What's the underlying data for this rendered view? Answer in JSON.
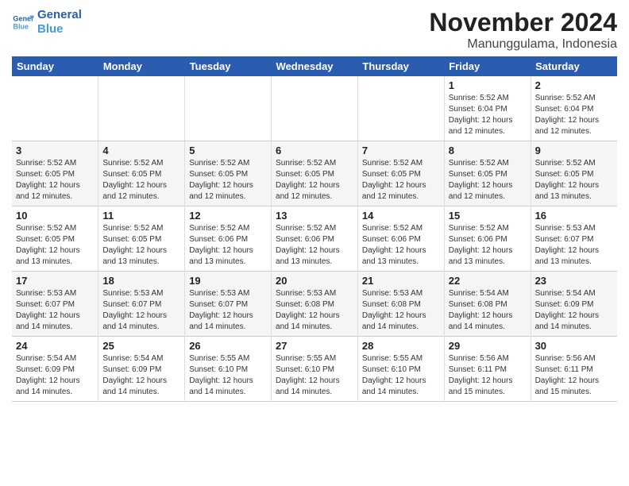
{
  "title": "November 2024",
  "subtitle": "Manunggulama, Indonesia",
  "logo": {
    "line1": "General",
    "line2": "Blue"
  },
  "weekdays": [
    "Sunday",
    "Monday",
    "Tuesday",
    "Wednesday",
    "Thursday",
    "Friday",
    "Saturday"
  ],
  "weeks": [
    [
      {
        "day": "",
        "info": ""
      },
      {
        "day": "",
        "info": ""
      },
      {
        "day": "",
        "info": ""
      },
      {
        "day": "",
        "info": ""
      },
      {
        "day": "",
        "info": ""
      },
      {
        "day": "1",
        "info": "Sunrise: 5:52 AM\nSunset: 6:04 PM\nDaylight: 12 hours\nand 12 minutes."
      },
      {
        "day": "2",
        "info": "Sunrise: 5:52 AM\nSunset: 6:04 PM\nDaylight: 12 hours\nand 12 minutes."
      }
    ],
    [
      {
        "day": "3",
        "info": "Sunrise: 5:52 AM\nSunset: 6:05 PM\nDaylight: 12 hours\nand 12 minutes."
      },
      {
        "day": "4",
        "info": "Sunrise: 5:52 AM\nSunset: 6:05 PM\nDaylight: 12 hours\nand 12 minutes."
      },
      {
        "day": "5",
        "info": "Sunrise: 5:52 AM\nSunset: 6:05 PM\nDaylight: 12 hours\nand 12 minutes."
      },
      {
        "day": "6",
        "info": "Sunrise: 5:52 AM\nSunset: 6:05 PM\nDaylight: 12 hours\nand 12 minutes."
      },
      {
        "day": "7",
        "info": "Sunrise: 5:52 AM\nSunset: 6:05 PM\nDaylight: 12 hours\nand 12 minutes."
      },
      {
        "day": "8",
        "info": "Sunrise: 5:52 AM\nSunset: 6:05 PM\nDaylight: 12 hours\nand 12 minutes."
      },
      {
        "day": "9",
        "info": "Sunrise: 5:52 AM\nSunset: 6:05 PM\nDaylight: 12 hours\nand 13 minutes."
      }
    ],
    [
      {
        "day": "10",
        "info": "Sunrise: 5:52 AM\nSunset: 6:05 PM\nDaylight: 12 hours\nand 13 minutes."
      },
      {
        "day": "11",
        "info": "Sunrise: 5:52 AM\nSunset: 6:05 PM\nDaylight: 12 hours\nand 13 minutes."
      },
      {
        "day": "12",
        "info": "Sunrise: 5:52 AM\nSunset: 6:06 PM\nDaylight: 12 hours\nand 13 minutes."
      },
      {
        "day": "13",
        "info": "Sunrise: 5:52 AM\nSunset: 6:06 PM\nDaylight: 12 hours\nand 13 minutes."
      },
      {
        "day": "14",
        "info": "Sunrise: 5:52 AM\nSunset: 6:06 PM\nDaylight: 12 hours\nand 13 minutes."
      },
      {
        "day": "15",
        "info": "Sunrise: 5:52 AM\nSunset: 6:06 PM\nDaylight: 12 hours\nand 13 minutes."
      },
      {
        "day": "16",
        "info": "Sunrise: 5:53 AM\nSunset: 6:07 PM\nDaylight: 12 hours\nand 13 minutes."
      }
    ],
    [
      {
        "day": "17",
        "info": "Sunrise: 5:53 AM\nSunset: 6:07 PM\nDaylight: 12 hours\nand 14 minutes."
      },
      {
        "day": "18",
        "info": "Sunrise: 5:53 AM\nSunset: 6:07 PM\nDaylight: 12 hours\nand 14 minutes."
      },
      {
        "day": "19",
        "info": "Sunrise: 5:53 AM\nSunset: 6:07 PM\nDaylight: 12 hours\nand 14 minutes."
      },
      {
        "day": "20",
        "info": "Sunrise: 5:53 AM\nSunset: 6:08 PM\nDaylight: 12 hours\nand 14 minutes."
      },
      {
        "day": "21",
        "info": "Sunrise: 5:53 AM\nSunset: 6:08 PM\nDaylight: 12 hours\nand 14 minutes."
      },
      {
        "day": "22",
        "info": "Sunrise: 5:54 AM\nSunset: 6:08 PM\nDaylight: 12 hours\nand 14 minutes."
      },
      {
        "day": "23",
        "info": "Sunrise: 5:54 AM\nSunset: 6:09 PM\nDaylight: 12 hours\nand 14 minutes."
      }
    ],
    [
      {
        "day": "24",
        "info": "Sunrise: 5:54 AM\nSunset: 6:09 PM\nDaylight: 12 hours\nand 14 minutes."
      },
      {
        "day": "25",
        "info": "Sunrise: 5:54 AM\nSunset: 6:09 PM\nDaylight: 12 hours\nand 14 minutes."
      },
      {
        "day": "26",
        "info": "Sunrise: 5:55 AM\nSunset: 6:10 PM\nDaylight: 12 hours\nand 14 minutes."
      },
      {
        "day": "27",
        "info": "Sunrise: 5:55 AM\nSunset: 6:10 PM\nDaylight: 12 hours\nand 14 minutes."
      },
      {
        "day": "28",
        "info": "Sunrise: 5:55 AM\nSunset: 6:10 PM\nDaylight: 12 hours\nand 14 minutes."
      },
      {
        "day": "29",
        "info": "Sunrise: 5:56 AM\nSunset: 6:11 PM\nDaylight: 12 hours\nand 15 minutes."
      },
      {
        "day": "30",
        "info": "Sunrise: 5:56 AM\nSunset: 6:11 PM\nDaylight: 12 hours\nand 15 minutes."
      }
    ]
  ]
}
